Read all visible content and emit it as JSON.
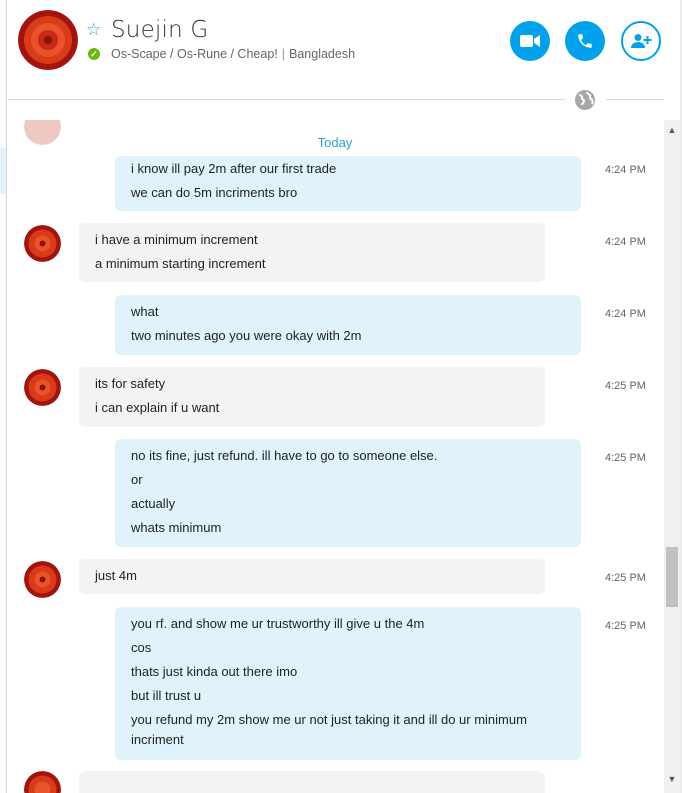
{
  "contact": {
    "name": "Suejin G",
    "mood_message": "Os-Scape / Os-Rune / Cheap!",
    "location": "Bangladesh",
    "status": "online"
  },
  "header_icons": {
    "favorite": "star-outline-icon",
    "video": "video-camera-icon",
    "call": "phone-icon",
    "add": "add-person-icon",
    "globe": "globe-icon"
  },
  "colors": {
    "accent": "#00a2ed",
    "status_online": "#6bb70c",
    "incoming_bubble": "#f1f3f5",
    "outgoing_bubble": "#e0f3fc"
  },
  "date_separator": "Today",
  "messages": [
    {
      "direction": "out",
      "time": "4:24 PM",
      "lines": [
        "i know ill pay 2m after our first trade",
        "we can do 5m incriments bro"
      ]
    },
    {
      "direction": "in",
      "time": "4:24 PM",
      "lines": [
        "i have a minimum increment",
        "a minimum starting increment"
      ]
    },
    {
      "direction": "out",
      "time": "4:24 PM",
      "lines": [
        "what",
        "two minutes ago you were okay with 2m"
      ]
    },
    {
      "direction": "in",
      "time": "4:25 PM",
      "lines": [
        "its for safety",
        "i can explain if u want"
      ]
    },
    {
      "direction": "out",
      "time": "4:25 PM",
      "lines": [
        "no its fine, just refund. ill have to go to someone else.",
        "or",
        "actually",
        "whats minimum"
      ]
    },
    {
      "direction": "in",
      "time": "4:25 PM",
      "lines": [
        "just 4m"
      ]
    },
    {
      "direction": "out",
      "time": "4:25 PM",
      "lines": [
        "you rf. and show me ur trustworthy ill give u the 4m",
        "cos",
        "thats just kinda out there imo",
        "but ill trust u",
        "you refund my 2m show me ur not just taking it and ill do ur minimum incriment"
      ]
    }
  ]
}
